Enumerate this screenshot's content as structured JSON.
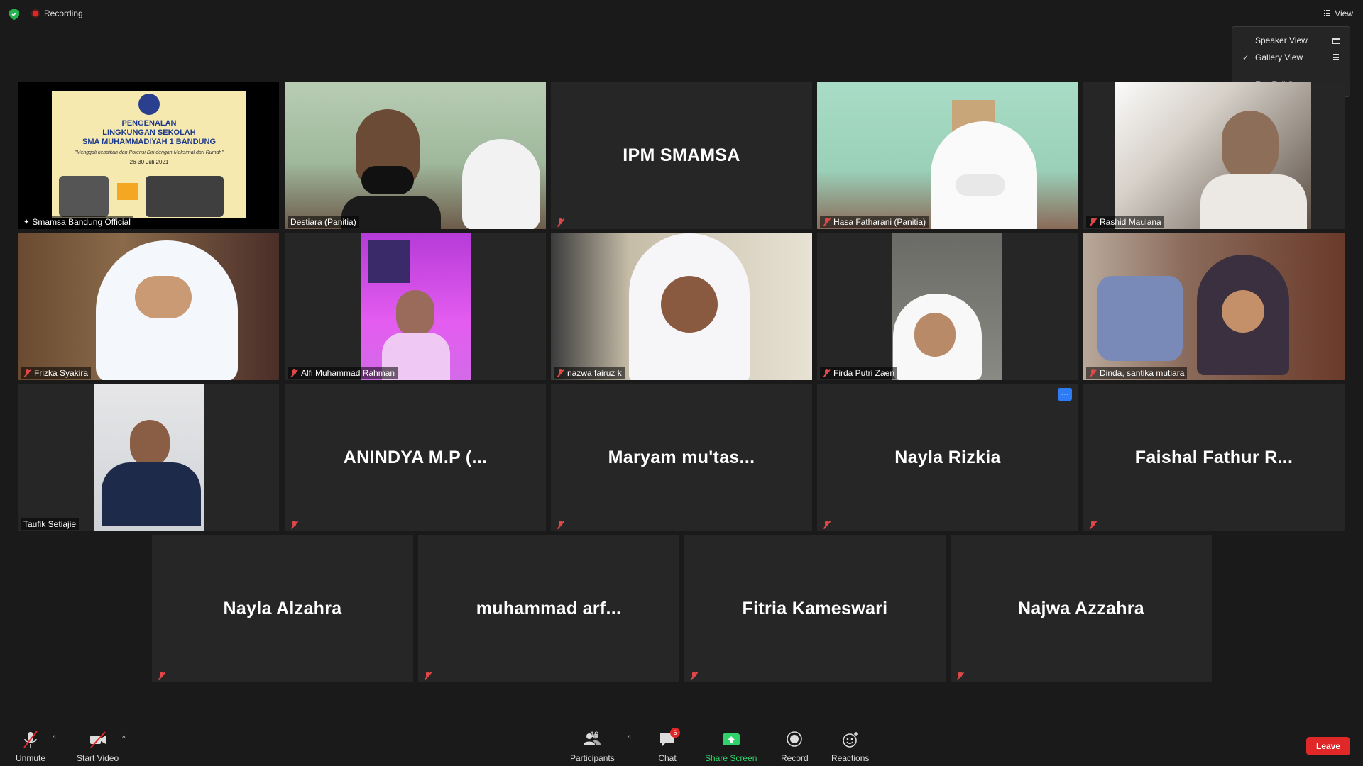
{
  "topbar": {
    "recording_label": "Recording",
    "view_label": "View"
  },
  "view_menu": {
    "speaker_view": "Speaker View",
    "gallery_view": "Gallery View",
    "exit_full_screen": "Exit Full Screen",
    "check": "✓"
  },
  "tiles": {
    "t1": {
      "name": "Smamsa Bandung Official"
    },
    "t2": {
      "name": "Destiara (Panitia)"
    },
    "t3": {
      "name": "IPM SMAMSA"
    },
    "t4": {
      "name": "Hasa Fatharani (Panitia)"
    },
    "t5": {
      "name": "Rashid Maulana"
    },
    "t6": {
      "name": "Frizka Syakira"
    },
    "t7": {
      "name": "Alfi Muhammad Rahman"
    },
    "t8": {
      "name": "nazwa fairuz k"
    },
    "t9": {
      "name": "Firda Putri Zaen"
    },
    "t10": {
      "name": "Dinda, santika mutiara"
    },
    "t11": {
      "name": "Taufik Setiajie"
    },
    "t12": {
      "display": "ANINDYA M.P (..."
    },
    "t13": {
      "display": "Maryam  mu'tas..."
    },
    "t14": {
      "display": "Nayla Rizkia",
      "more": "···"
    },
    "t15": {
      "display": "Faishal  Fathur R..."
    },
    "t16": {
      "display": "Nayla Alzahra"
    },
    "t17": {
      "display": "muhammad  arf..."
    },
    "t18": {
      "display": "Fitria Kameswari"
    },
    "t19": {
      "display": "Najwa Azzahra"
    }
  },
  "slide": {
    "line1": "PENGENALAN",
    "line2": "LINGKUNGAN SEKOLAH",
    "line3": "SMA MUHAMMADIYAH 1 BANDUNG",
    "tagline": "\"Menggali kebaikan dan Potensi Diri dengan Maksimal dari Rumah\"",
    "date": "26-30 Juli 2021"
  },
  "toolbar": {
    "unmute": "Unmute",
    "start_video": "Start Video",
    "participants": "Participants",
    "participants_count": "19",
    "chat": "Chat",
    "chat_badge": "6",
    "share_screen": "Share Screen",
    "record": "Record",
    "reactions": "Reactions",
    "leave": "Leave",
    "caret": "^"
  },
  "colors": {
    "accent_green": "#2fd36b",
    "leave_red": "#e02828",
    "active_border": "#e6e96a",
    "tile_bg": "#262626",
    "bg": "#1a1a1a"
  }
}
